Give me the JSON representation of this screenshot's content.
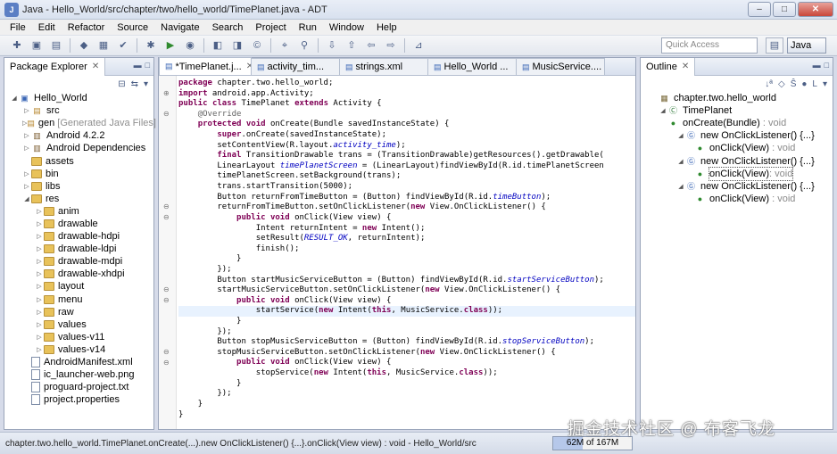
{
  "window": {
    "title": "Java - Hello_World/src/chapter/two/hello_world/TimePlanet.java - ADT",
    "app_icon_label": "J",
    "minimize_glyph": "–",
    "maximize_glyph": "□",
    "close_glyph": "✕"
  },
  "menu": [
    "File",
    "Edit",
    "Refactor",
    "Source",
    "Navigate",
    "Search",
    "Project",
    "Run",
    "Window",
    "Help"
  ],
  "toolbar": {
    "quick_access_placeholder": "Quick Access",
    "open_perspective_glyph": "▤",
    "perspective_label": "Java"
  },
  "package_explorer": {
    "tab_label": "Package Explorer",
    "close_glyph": "✕",
    "tree": [
      {
        "label": "Hello_World",
        "decor": "",
        "depth": 0,
        "expanded": true,
        "icon": "project"
      },
      {
        "label": "src",
        "decor": "",
        "depth": 1,
        "expanded": false,
        "icon": "pkg"
      },
      {
        "label": "gen",
        "decor": "[Generated Java Files]",
        "depth": 1,
        "expanded": false,
        "icon": "pkg"
      },
      {
        "label": "Android 4.2.2",
        "decor": "",
        "depth": 1,
        "expanded": false,
        "icon": "lib"
      },
      {
        "label": "Android Dependencies",
        "decor": "",
        "depth": 1,
        "expanded": false,
        "icon": "lib"
      },
      {
        "label": "assets",
        "decor": "",
        "depth": 1,
        "expanded": null,
        "icon": "folder"
      },
      {
        "label": "bin",
        "decor": "",
        "depth": 1,
        "expanded": false,
        "icon": "folder"
      },
      {
        "label": "libs",
        "decor": "",
        "depth": 1,
        "expanded": false,
        "icon": "folder"
      },
      {
        "label": "res",
        "decor": "",
        "depth": 1,
        "expanded": true,
        "icon": "folder"
      },
      {
        "label": "anim",
        "decor": "",
        "depth": 2,
        "expanded": false,
        "icon": "folder"
      },
      {
        "label": "drawable",
        "decor": "",
        "depth": 2,
        "expanded": false,
        "icon": "folder"
      },
      {
        "label": "drawable-hdpi",
        "decor": "",
        "depth": 2,
        "expanded": false,
        "icon": "folder"
      },
      {
        "label": "drawable-ldpi",
        "decor": "",
        "depth": 2,
        "expanded": false,
        "icon": "folder"
      },
      {
        "label": "drawable-mdpi",
        "decor": "",
        "depth": 2,
        "expanded": false,
        "icon": "folder"
      },
      {
        "label": "drawable-xhdpi",
        "decor": "",
        "depth": 2,
        "expanded": false,
        "icon": "folder"
      },
      {
        "label": "layout",
        "decor": "",
        "depth": 2,
        "expanded": false,
        "icon": "folder"
      },
      {
        "label": "menu",
        "decor": "",
        "depth": 2,
        "expanded": false,
        "icon": "folder"
      },
      {
        "label": "raw",
        "decor": "",
        "depth": 2,
        "expanded": false,
        "icon": "folder"
      },
      {
        "label": "values",
        "decor": "",
        "depth": 2,
        "expanded": false,
        "icon": "folder"
      },
      {
        "label": "values-v11",
        "decor": "",
        "depth": 2,
        "expanded": false,
        "icon": "folder"
      },
      {
        "label": "values-v14",
        "decor": "",
        "depth": 2,
        "expanded": false,
        "icon": "folder"
      },
      {
        "label": "AndroidManifest.xml",
        "decor": "",
        "depth": 1,
        "expanded": null,
        "icon": "file"
      },
      {
        "label": "ic_launcher-web.png",
        "decor": "",
        "depth": 1,
        "expanded": null,
        "icon": "file"
      },
      {
        "label": "proguard-project.txt",
        "decor": "",
        "depth": 1,
        "expanded": null,
        "icon": "file"
      },
      {
        "label": "project.properties",
        "decor": "",
        "depth": 1,
        "expanded": null,
        "icon": "file"
      }
    ]
  },
  "editor": {
    "tabs": [
      {
        "label": "*TimePlanet.j...",
        "active": true
      },
      {
        "label": "activity_tim...",
        "active": false
      },
      {
        "label": "strings.xml",
        "active": false
      },
      {
        "label": "Hello_World ...",
        "active": false
      },
      {
        "label": "MusicService....",
        "active": false
      }
    ],
    "close_glyph": "✕",
    "more_tabs_label": "»₁₂",
    "lines": [
      {
        "t": "package chapter.two.hello_world;",
        "k": "package"
      },
      {
        "t": "import android.app.Activity;",
        "k": "import",
        "fold": "+"
      },
      {
        "t": "public class TimePlanet extends Activity {",
        "k": "class"
      },
      {
        "t": "    @Override",
        "k": "ann",
        "fold": "-"
      },
      {
        "t": "    protected void onCreate(Bundle savedInstanceState) {",
        "k": "method"
      },
      {
        "t": "        super.onCreate(savedInstanceState);",
        "k": "super"
      },
      {
        "t": "        setContentView(R.layout.activity_time);",
        "k": "fld",
        "f": "activity_time"
      },
      {
        "t": "        final TransitionDrawable trans = (TransitionDrawable)getResources().getDrawable(",
        "k": "final"
      },
      {
        "t": "        LinearLayout timePlanetScreen = (LinearLayout)findViewById(R.id.timePlanetScreen",
        "k": "fld",
        "f": "timePlanetScreen"
      },
      {
        "t": "        timePlanetScreen.setBackground(trans);",
        "k": ""
      },
      {
        "t": "        trans.startTransition(5000);",
        "k": ""
      },
      {
        "t": "        Button returnFromTimeButton = (Button) findViewById(R.id.timeButton);",
        "k": "fld",
        "f": "timeButton"
      },
      {
        "t": "        returnFromTimeButton.setOnClickListener(new View.OnClickListener() {",
        "k": "new",
        "fold": "-"
      },
      {
        "t": "            public void onClick(View view) {",
        "k": "method",
        "fold": "-"
      },
      {
        "t": "                Intent returnIntent = new Intent();",
        "k": "new"
      },
      {
        "t": "                setResult(RESULT_OK, returnIntent);",
        "k": "fld",
        "f": "RESULT_OK"
      },
      {
        "t": "                finish();",
        "k": ""
      },
      {
        "t": "            }",
        "k": ""
      },
      {
        "t": "        });",
        "k": ""
      },
      {
        "t": "        Button startMusicServiceButton = (Button) findViewById(R.id.startServiceButton);",
        "k": "fld",
        "f": "startServiceButton"
      },
      {
        "t": "        startMusicServiceButton.setOnClickListener(new View.OnClickListener() {",
        "k": "new",
        "fold": "-"
      },
      {
        "t": "            public void onClick(View view) {",
        "k": "method",
        "fold": "-"
      },
      {
        "t": "                startService(new Intent(this, MusicService.class));",
        "k": "new",
        "hl": true
      },
      {
        "t": "            }",
        "k": ""
      },
      {
        "t": "        });",
        "k": ""
      },
      {
        "t": "        Button stopMusicServiceButton = (Button) findViewById(R.id.stopServiceButton);",
        "k": "fld",
        "f": "stopServiceButton"
      },
      {
        "t": "        stopMusicServiceButton.setOnClickListener(new View.OnClickListener() {",
        "k": "new",
        "fold": "-"
      },
      {
        "t": "            public void onClick(View view) {",
        "k": "method",
        "fold": "-"
      },
      {
        "t": "                stopService(new Intent(this, MusicService.class));",
        "k": "new"
      },
      {
        "t": "            }",
        "k": ""
      },
      {
        "t": "        });",
        "k": ""
      },
      {
        "t": "    }",
        "k": ""
      },
      {
        "t": "}",
        "k": ""
      }
    ]
  },
  "outline": {
    "tab_label": "Outline",
    "close_glyph": "✕",
    "items": [
      {
        "label": "chapter.two.hello_world",
        "suffix": "",
        "depth": 0,
        "icon": "package",
        "selected": false
      },
      {
        "label": "TimePlanet",
        "suffix": "",
        "depth": 0,
        "icon": "class",
        "selected": false
      },
      {
        "label": "onCreate(Bundle)",
        "suffix": " : void",
        "depth": 1,
        "icon": "method",
        "selected": false
      },
      {
        "label": "new OnClickListener() {...}",
        "suffix": "",
        "depth": 2,
        "icon": "anon",
        "selected": false
      },
      {
        "label": "onClick(View)",
        "suffix": " : void",
        "depth": 3,
        "icon": "method",
        "selected": false
      },
      {
        "label": "new OnClickListener() {...}",
        "suffix": "",
        "depth": 2,
        "icon": "anon",
        "selected": false
      },
      {
        "label": "onClick(View)",
        "suffix": " : void",
        "depth": 3,
        "icon": "method",
        "selected": true
      },
      {
        "label": "new OnClickListener() {...}",
        "suffix": "",
        "depth": 2,
        "icon": "anon",
        "selected": false
      },
      {
        "label": "onClick(View)",
        "suffix": " : void",
        "depth": 3,
        "icon": "method",
        "selected": false
      }
    ]
  },
  "status": {
    "text": "chapter.two.hello_world.TimePlanet.onCreate(...).new OnClickListener() {...}.onClick(View view) : void - Hello_World/src",
    "heap": "62M of 167M",
    "heap_fraction": 0.37
  },
  "watermark": "掘金技术社区 @ 布客飞龙",
  "colors": {
    "keyword": "#7f0055",
    "field": "#0000c0",
    "annotation": "#646464",
    "highlight_line": "#e8f2fe",
    "chrome": "#d6dbe9"
  }
}
